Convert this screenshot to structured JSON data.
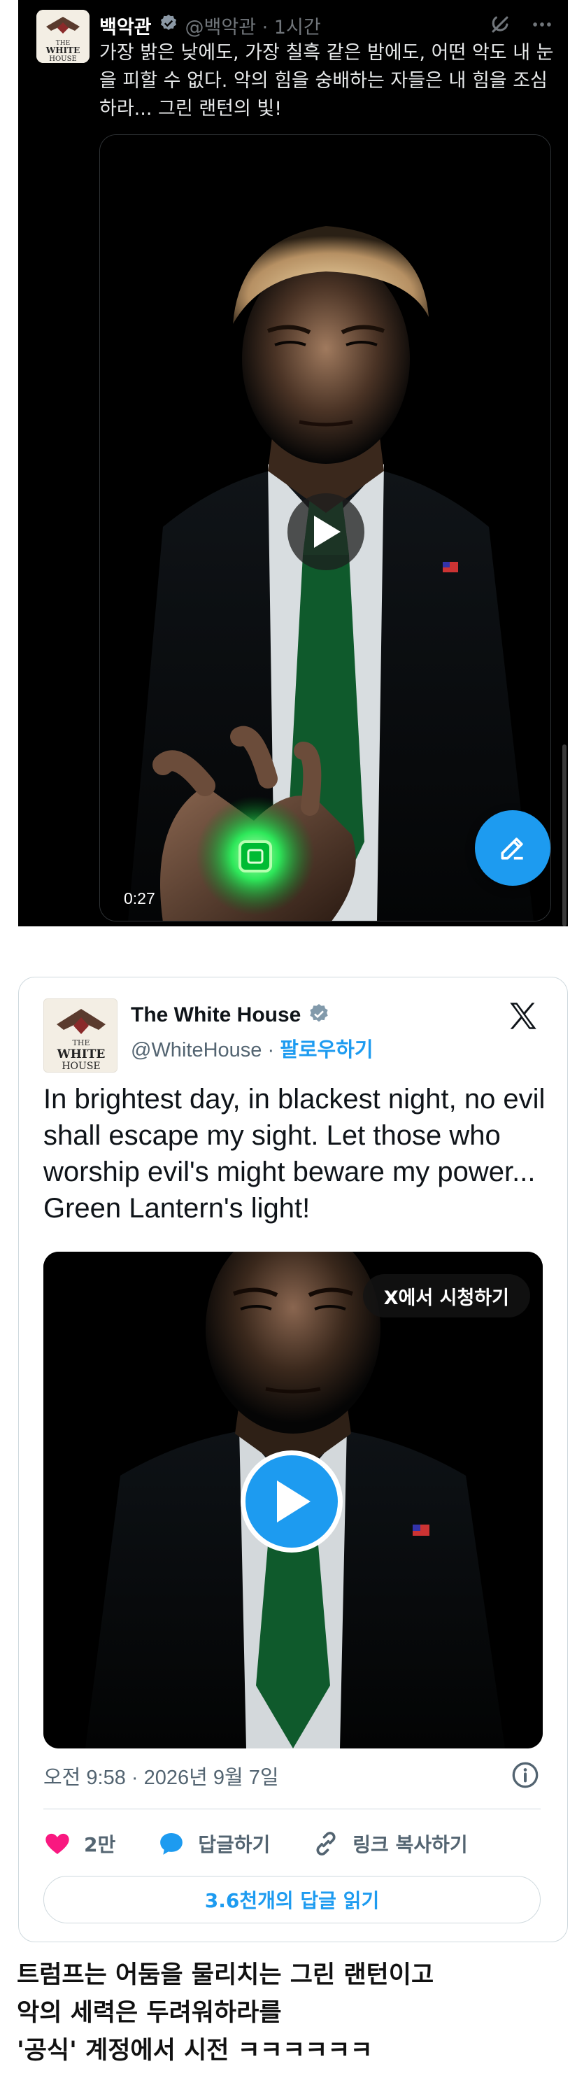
{
  "dark_tweet": {
    "display_name": "백악관",
    "handle_time": "@백악관 · 1시간",
    "text": "가장 밝은 낮에도, 가장 칠흑 같은 밤에도, 어떤 악도 내 눈을 피할 수 없다. 악의 힘을 숭배하는 자들은 내 힘을 조심하라... 그린 랜턴의 빛!",
    "video_duration": "0:27",
    "avatar_logo_text": "THE WHITE HOUSE",
    "icons": [
      "verified-badge-icon",
      "grok-icon",
      "more-icon",
      "play-icon",
      "compose-icon"
    ]
  },
  "embed_tweet": {
    "display_name": "The White House",
    "handle": "@WhiteHouse",
    "separator": " · ",
    "follow_label": "팔로우하기",
    "text": "In brightest day, in blackest night, no evil shall escape my sight. Let those who worship evil's might beware my power... Green Lantern's light!",
    "watch_on_x_label": "X에서 시청하기",
    "timestamp": "오전 9:58 · 2026년 9월 7일",
    "actions": {
      "like_count": "2만",
      "reply_label": "답글하기",
      "copy_link_label": "링크 복사하기"
    },
    "read_replies_label": "3.6천개의 답글 읽기",
    "avatar_logo_text": "THE WHITE HOUSE",
    "colors": {
      "accent": "#1d9bf0",
      "like": "#f91880",
      "text": "#0f1419",
      "muted": "#536471"
    }
  },
  "caption": {
    "line1": "트럼프는 어둠을 물리치는 그린 랜턴이고",
    "line2": "악의 세력은 두려워하라를",
    "line3": "'공식' 계정에서 시전 ㅋㅋㅋㅋㅋㅋ"
  }
}
